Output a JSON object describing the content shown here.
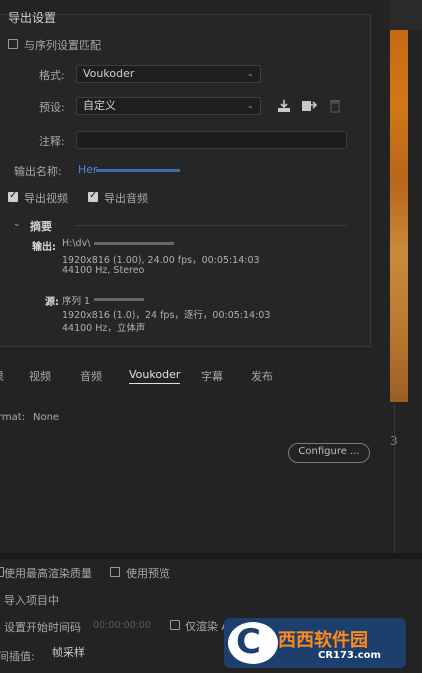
{
  "export_settings": {
    "title": "导出设置",
    "match_sequence_label": "与序列设置匹配",
    "format_label": "格式:",
    "format_value": "Voukoder",
    "preset_label": "预设:",
    "preset_value": "自定义",
    "comment_label": "注释:",
    "output_name_label": "输出名称:",
    "output_name_value": "Her",
    "export_video_label": "导出视频",
    "export_audio_label": "导出音频",
    "summary_label": "摘要",
    "output_label": "输出:",
    "output_path": "H:\\dv\\",
    "output_line2": "1920x816 (1.00), 24.00 fps，00:05:14:03",
    "output_line3": "44100 Hz, Stereo",
    "source_label": "源:",
    "source_name": "序列 1",
    "source_line2": "1920x816 (1.0)，24 fps，逐行，00:05:14:03",
    "source_line3": "44100 Hz，立体声"
  },
  "tabs": [
    "果",
    "视频",
    "音频",
    "Voukoder",
    "字幕",
    "发布"
  ],
  "active_tab": "Voukoder",
  "voukoder": {
    "format_label": "rmat:",
    "format_value": "None",
    "configure_button": "Configure ..."
  },
  "right_number": "3",
  "bottom": {
    "max_quality_label": "使用最高渲染质量",
    "use_preview_label": "使用预览",
    "import_project_label": "导入项目中",
    "set_start_tc_label": "设置开始时间码",
    "start_tc_value": "00:00:00:00",
    "render_alpha_label": "仅渲染 Alpha 通道",
    "interpolation_label": "间插值:",
    "interpolation_value": "帧采样"
  },
  "watermark": {
    "brand": "西西软件园",
    "url": "CR173.com"
  },
  "colors": {
    "accent_blue": "#4a8fd8",
    "background": "#232323",
    "photo_orange": "#c56a12"
  }
}
